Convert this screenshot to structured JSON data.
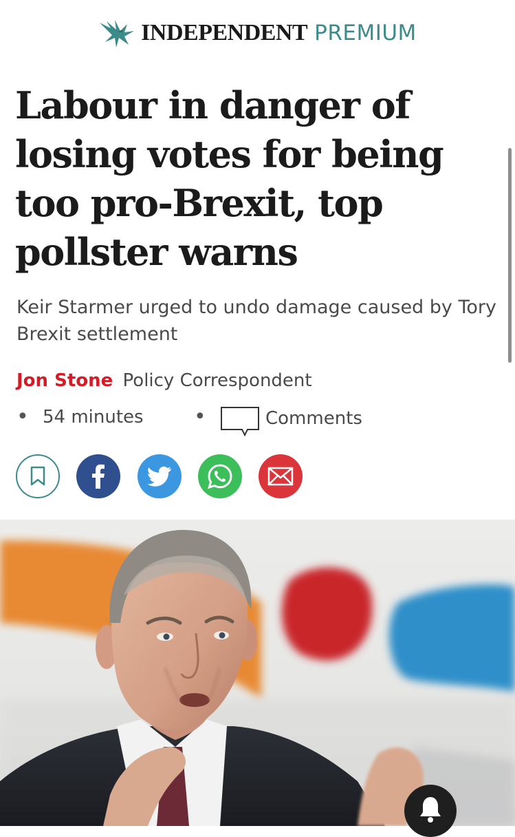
{
  "masthead": {
    "brand": "INDEPENDENT",
    "premium": "PREMIUM",
    "logo_icon": "eagle-icon",
    "premium_color": "#3b8b8a"
  },
  "article": {
    "headline": "Labour in danger of losing votes for being too pro-Brexit, top pollster warns",
    "standfirst": "Keir Starmer urged to undo damage caused by Tory Brexit settlement",
    "author": "Jon Stone",
    "author_color": "#d31c26",
    "role": "Policy Correspondent",
    "time": "54 minutes",
    "comments_label": "Comments",
    "comments_icon": "speech-bubble-icon"
  },
  "share": {
    "buttons": [
      {
        "name": "bookmark",
        "icon": "bookmark-icon",
        "color": "#3b8b8a"
      },
      {
        "name": "facebook",
        "icon": "facebook-icon",
        "color": "#2f4f8f"
      },
      {
        "name": "twitter",
        "icon": "twitter-icon",
        "color": "#3a97e0"
      },
      {
        "name": "whatsapp",
        "icon": "whatsapp-icon",
        "color": "#3cbf5a"
      },
      {
        "name": "email",
        "icon": "mail-icon",
        "color": "#d9353a"
      }
    ]
  },
  "hero_image": {
    "subject": "Keir Starmer speaking, gesturing with hands, in front of coloured backdrop",
    "alt_colors": [
      "#e8852c",
      "#c9262c",
      "#2f8fc9"
    ]
  },
  "overlay": {
    "notification_icon": "bell-icon"
  }
}
